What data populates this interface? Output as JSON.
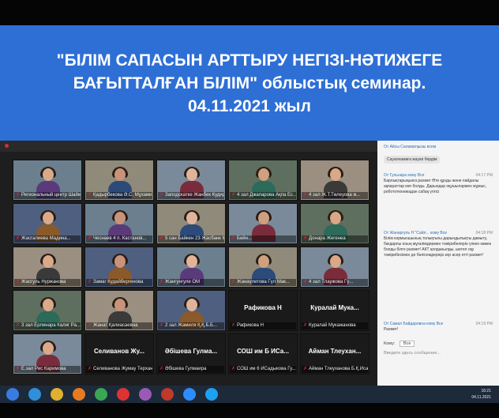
{
  "banner": {
    "line1": "\"БІЛІМ САПАСЫН АРТТЫРУ НЕГІЗІ-НӘТИЖЕГЕ",
    "line2": "БАҒЫТТАЛҒАН БІЛІМ\" облыстық семинар.",
    "line3": "04.11.2021 жыл"
  },
  "tiles": [
    {
      "name": "Региональный центр Шайм..."
    },
    {
      "name": "Қадырбекова Ә.С. Мұхами..."
    },
    {
      "name": "Заподскатке Жанбек Кудир..."
    },
    {
      "name": "4 зал Джапарова Ақпа Ес..."
    },
    {
      "name": "4 зал Ж.Т.Төлеуова ж..."
    },
    {
      "name": "Жасгалиева Мадина..."
    },
    {
      "name": "Чеснаев 4 п. Кастанов..."
    },
    {
      "name": "5 сан Байкен 23 Жасбанк М..."
    },
    {
      "name": "Бейн..."
    },
    {
      "name": "Донара Жегенеа"
    },
    {
      "name": "Жасгуль Нуржанова"
    },
    {
      "name": "Замаг Кудайбергенова"
    },
    {
      "name": "Жангунгуле ОМ"
    },
    {
      "name": "Жанаүлетова Гүл Мак..."
    },
    {
      "name": "4 зал Тлаужова Гү..."
    },
    {
      "name": "3 зал Ерлинара Калиг Ра..."
    },
    {
      "name": "Жанат Қалиасаевна"
    },
    {
      "name": "2 зал Жамиля Қ.Қ.Б.Б..."
    },
    {
      "name": "Рафикова Н",
      "big": "Рафикова Н"
    },
    {
      "name": "Куралай Мукажанова",
      "big": "Куралай Мука..."
    },
    {
      "name": "Е.зал Рис Каримова"
    },
    {
      "name": "Селиванова Жумау Терхана...",
      "big": "Селиванов Жу..."
    },
    {
      "name": "Әбішева Гулмаира",
      "big": "Әбішева Гулма..."
    },
    {
      "name": "СОШ им 6 ИСадыкова Гу...",
      "big": "СОШ им Б ИСа..."
    },
    {
      "name": "Айман Тлеуханова Б.Қ.Исад...",
      "big": "Айман Тлеухан..."
    }
  ],
  "chat": {
    "messages": [
      {
        "from": "От Айсы Саламатқызы всем",
        "time": "",
        "text": "Сауалнамаға жауап бердім"
      },
      {
        "from": "От Гульнара кому Все",
        "time": "04:17 PM",
        "text": "Барлықтарыңызға рахмет Өте құнды және пайдалы ақпараттар көп болды. Дарындар оқушылармен жұмыс, робототехникадан сабақ үлгісі"
      },
      {
        "from": "От Жанаргуль Н \"Сайл... кому Все",
        "time": "04:18 PM",
        "text": "Білім кормыншының толықтығы дарындылықты дамыту, бағдарлы оның мұғалімдермен тәжірибелерін үлкен көмек болды білге рахмет! АКТ қолданылды, шетел оқу тәжірибесімен де бөлісемдеріңіз зор асер етті рахмет!"
      },
      {
        "from": "От Самал Байдаровна кому Все",
        "time": "04:19 PM",
        "text": "Рахмет!"
      }
    ],
    "to_label": "Кому:",
    "to_value": "Все",
    "input_placeholder": "Введите здесь сообщение..."
  },
  "taskbar": {
    "time": "16:21",
    "date": "04.11.2021"
  }
}
